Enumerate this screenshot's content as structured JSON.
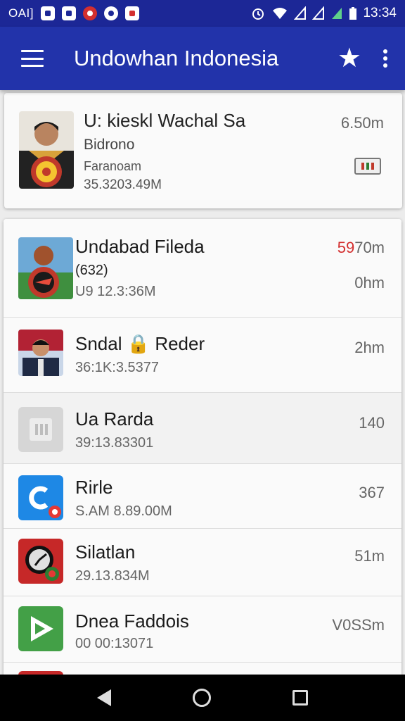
{
  "status_bar": {
    "carrier": "OAI]",
    "time": "13:34",
    "icons": [
      "save-icon",
      "printer-icon",
      "red-circle-icon",
      "round-icon",
      "flag-icon",
      "alarm-icon",
      "wifi-icon",
      "signal-icon",
      "signal-icon",
      "signal-icon",
      "battery-icon"
    ]
  },
  "app_bar": {
    "title": "Undowhan Indonesia",
    "menu_icon": "hamburger-menu-icon",
    "star_icon": "star-icon",
    "overflow_icon": "overflow-menu-icon",
    "color": "#2233aa"
  },
  "featured": {
    "name": "U: kieskl Wachal Sa",
    "sub1": "Bidrono",
    "sub2": "Faranoam",
    "sub3": "35.3203.49M",
    "value": "6.50m",
    "badge_icon": "chart-badge-icon"
  },
  "list": [
    {
      "name": "Undabad Fileda",
      "sub1": "(632)",
      "sub2": "U9 12.3:36M",
      "value_red": "59",
      "value_rest": "70m",
      "value2": "0hm"
    },
    {
      "name": "Sndal 🔒 Reder",
      "sub1": "36:1K:3.5377",
      "value": "2hm"
    },
    {
      "name": "Ua Rarda",
      "sub1": "39:13.83301",
      "value": "140"
    },
    {
      "name": "Rirle",
      "sub1": "S.AM 8.89.00M",
      "value": "367"
    },
    {
      "name": "Silatlan",
      "sub1": "29.13.834M",
      "value": "51m"
    },
    {
      "name": "Dnea Faddois",
      "sub1": "00 00:13071",
      "value": "V0SSm"
    }
  ],
  "nav_bar": {
    "back": "back-icon",
    "home": "home-icon",
    "recents": "recents-icon"
  },
  "colors": {
    "status_bar": "#1c2796",
    "accent_red": "#d32f2f"
  }
}
